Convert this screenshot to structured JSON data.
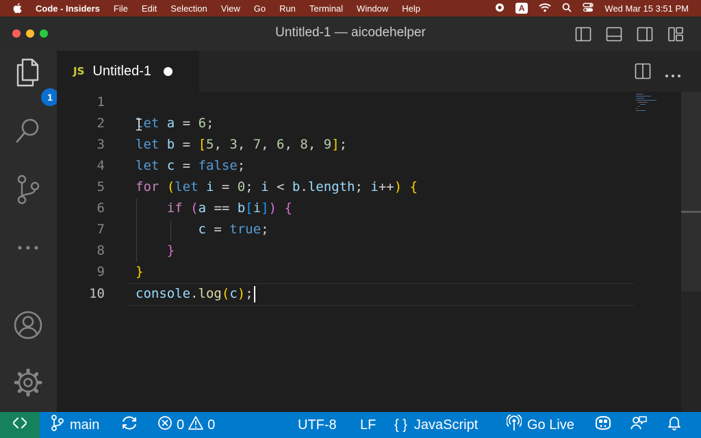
{
  "menubar": {
    "app_name": "Code - Insiders",
    "items": [
      "File",
      "Edit",
      "Selection",
      "View",
      "Go",
      "Run",
      "Terminal",
      "Window",
      "Help"
    ],
    "keyboard_indicator": "A",
    "datetime": "Wed Mar 15  3:51 PM"
  },
  "window": {
    "title": "Untitled-1 — aicodehelper"
  },
  "activity_bar": {
    "explorer_badge": "1"
  },
  "tab": {
    "type_label": "JS",
    "name": "Untitled-1"
  },
  "editor": {
    "line_numbers": [
      "1",
      "2",
      "3",
      "4",
      "5",
      "6",
      "7",
      "8",
      "9",
      "10"
    ],
    "active_line": "10",
    "language": "javascript",
    "lines": [
      "",
      "let a = 6;",
      "let b = [5, 3, 7, 6, 8, 9];",
      "let c = false;",
      "for (let i = 0; i < b.length; i++) {",
      "    if (a == b[i]) {",
      "        c = true;",
      "    }",
      "}",
      "console.log(c);"
    ]
  },
  "statusbar": {
    "branch": "main",
    "errors": "0",
    "warnings": "0",
    "encoding": "UTF-8",
    "eol": "LF",
    "language_braces": "{ }",
    "language": "JavaScript",
    "go_live": "Go Live"
  },
  "colors": {
    "menubar_bg": "#7a2a1c",
    "statusbar_bg": "#007acc",
    "remote_bg": "#16825d",
    "badge_bg": "#0b6fd0",
    "keyword": "#569cd6",
    "control_keyword": "#c586c0",
    "variable": "#9cdcfe",
    "number": "#b5cea8",
    "function": "#dcdcaa"
  }
}
